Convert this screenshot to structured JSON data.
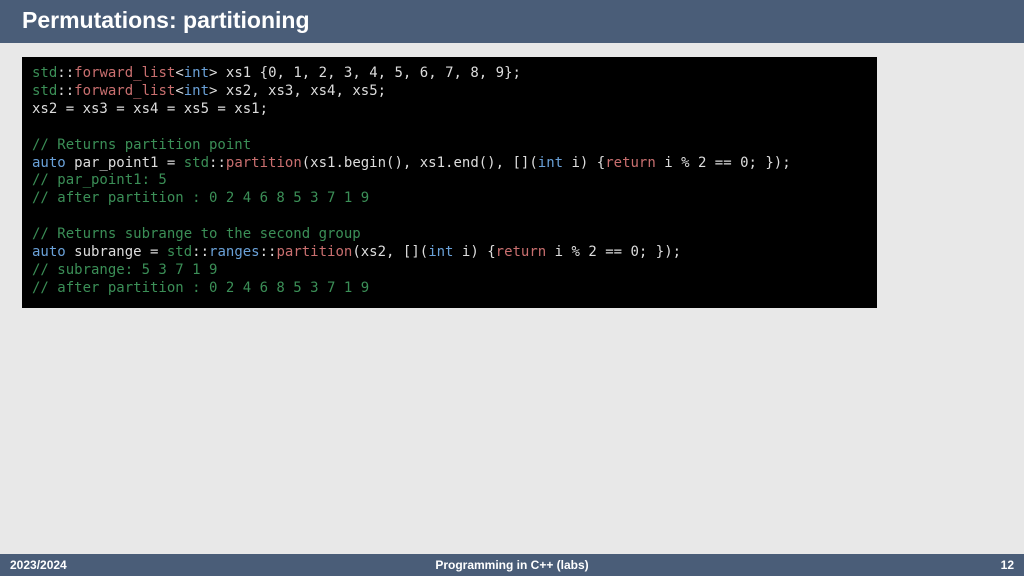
{
  "title": "Permutations: partitioning",
  "footer": {
    "left": "2023/2024",
    "center": "Programming in C++ (labs)",
    "right": "12"
  },
  "tokens": {
    "std": "std",
    "dcol": "::",
    "forward_list": "forward_list",
    "lt": "<",
    "gt": ">",
    "int": "int",
    "sp": " ",
    "xs1": "xs1",
    "xs2": "xs2",
    "xs3": "xs3",
    "xs4": "xs4",
    "xs5": "xs5",
    "init": " {0, 1, 2, 3, 4, 5, 6, 7, 8, 9};",
    "decl_rest": " xs2, xs3, xs4, xs5;",
    "assign_line": "xs2 = xs3 = xs4 = xs5 = xs1;",
    "cm1": "// Returns partition point",
    "auto": "auto",
    "par_point1": " par_point1 = ",
    "partition": "partition",
    "ranges": "ranges",
    "call1_a": "(xs1.begin(), xs1.end(), [](",
    "call1_b": " i) {",
    "return": "return",
    "mod": " i % 2 == 0; });",
    "cm2": "// par_point1: 5",
    "cm3": "// after partition : 0 2 4 6 8 5 3 7 1 9",
    "cm4": "// Returns subrange to the second group",
    "subrange_decl": " subrange = ",
    "call2_a": "(xs2, [](",
    "cm5": "// subrange: 5 3 7 1 9",
    "cm6": "// after partition : 0 2 4 6 8 5 3 7 1 9"
  }
}
